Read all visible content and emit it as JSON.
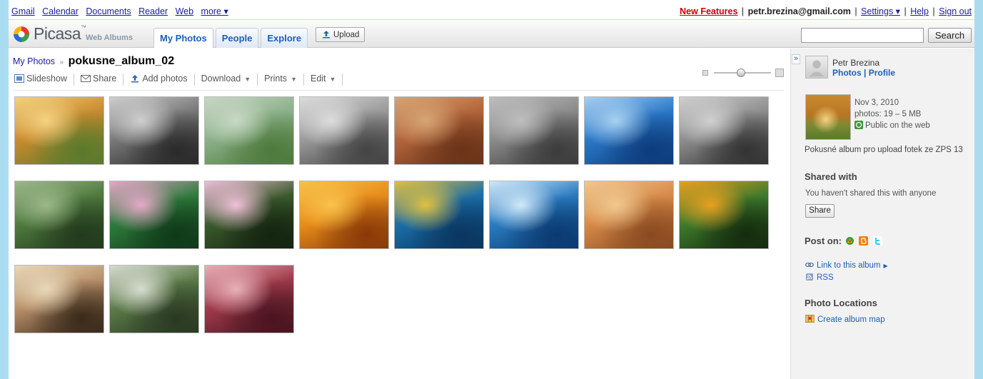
{
  "gbar": {
    "links": [
      "Gmail",
      "Calendar",
      "Documents",
      "Reader",
      "Web",
      "more ▾"
    ],
    "new_features": "New Features",
    "email": "petr.brezina@gmail.com",
    "settings": "Settings ▾",
    "help": "Help",
    "signout": "Sign out"
  },
  "header": {
    "logo_text": "Picasa",
    "logo_tm": "™",
    "logo_sub": "Web Albums",
    "tabs": [
      "My Photos",
      "People",
      "Explore"
    ],
    "active_tab": "My Photos",
    "upload_label": "Upload",
    "search_value": "",
    "search_button": "Search"
  },
  "breadcrumb": {
    "root": "My Photos",
    "album": "pokusne_album_02"
  },
  "toolbar": {
    "slideshow": "Slideshow",
    "share": "Share",
    "add_photos": "Add photos",
    "download": "Download",
    "prints": "Prints",
    "edit": "Edit"
  },
  "photos": [
    {
      "subject": "autumn-tree-sunrise",
      "c": [
        "#c98a2e",
        "#5a7a2c",
        "#f4d280"
      ]
    },
    {
      "subject": "autumn-tree-bw",
      "c": [
        "#777",
        "#2a2a2a",
        "#cfcfcf"
      ]
    },
    {
      "subject": "river-meadow",
      "c": [
        "#8bb08a",
        "#4e7a3c",
        "#c8d8c4"
      ]
    },
    {
      "subject": "river-meadow-bw",
      "c": [
        "#999",
        "#444",
        "#ddd"
      ]
    },
    {
      "subject": "monument-valley",
      "c": [
        "#b2643a",
        "#6a3318",
        "#d6a574"
      ]
    },
    {
      "subject": "monument-valley-bw",
      "c": [
        "#8a8a8a",
        "#3c3c3c",
        "#bebebe"
      ]
    },
    {
      "subject": "pier-blue-sky",
      "c": [
        "#2b78c8",
        "#0d3c7c",
        "#a8d0f0"
      ]
    },
    {
      "subject": "pier-blue-sky-bw",
      "c": [
        "#8d8d8d",
        "#333",
        "#d0d0d0"
      ]
    },
    {
      "subject": "forest-path",
      "c": [
        "#4f7a3e",
        "#223a1c",
        "#9cb88a"
      ]
    },
    {
      "subject": "pink-flowers",
      "c": [
        "#2e7a3c",
        "#0f3a18",
        "#e6a8c8"
      ]
    },
    {
      "subject": "frangipani",
      "c": [
        "#3a5a2c",
        "#142410",
        "#f0c0d8"
      ]
    },
    {
      "subject": "orange-daisies",
      "c": [
        "#e88c1a",
        "#8a3a08",
        "#f8c24a"
      ]
    },
    {
      "subject": "sea-turtle",
      "c": [
        "#1a6ea8",
        "#0a3660",
        "#e0c040"
      ]
    },
    {
      "subject": "whale-tail",
      "c": [
        "#2a7ac0",
        "#0a3a70",
        "#d0e8f8"
      ]
    },
    {
      "subject": "desert-oryx",
      "c": [
        "#d68a48",
        "#8a4a20",
        "#f0c890"
      ]
    },
    {
      "subject": "toucan",
      "c": [
        "#3e7a2c",
        "#142c0e",
        "#e8a020"
      ]
    },
    {
      "subject": "misty-trees",
      "c": [
        "#b8906a",
        "#3a2a1a",
        "#e8d8b8"
      ]
    },
    {
      "subject": "cascading-stream",
      "c": [
        "#5a7a48",
        "#2a3a22",
        "#d8dcd0"
      ]
    },
    {
      "subject": "frosted-leaves",
      "c": [
        "#a03a4a",
        "#4a1420",
        "#e8b0b8"
      ]
    }
  ],
  "sidebar": {
    "owner_name": "Petr Brezina",
    "owner_photos": "Photos",
    "owner_profile": "Profile",
    "date": "Nov 3, 2010",
    "photos_count": "photos: 19 – 5 MB",
    "visibility": "Public on the web",
    "description": "Pokusné album pro upload fotek ze ZPS 13",
    "shared_title": "Shared with",
    "shared_text": "You haven't shared this with anyone",
    "share_button": "Share",
    "post_on": "Post on:",
    "link_album": "Link to this album",
    "rss": "RSS",
    "locations_title": "Photo Locations",
    "create_map": "Create album map",
    "colors": {
      "link": "#1d5fb8",
      "public_icon": "#3a9a3a",
      "blogger": "#f57d00",
      "twitter": "#33ccff"
    }
  }
}
